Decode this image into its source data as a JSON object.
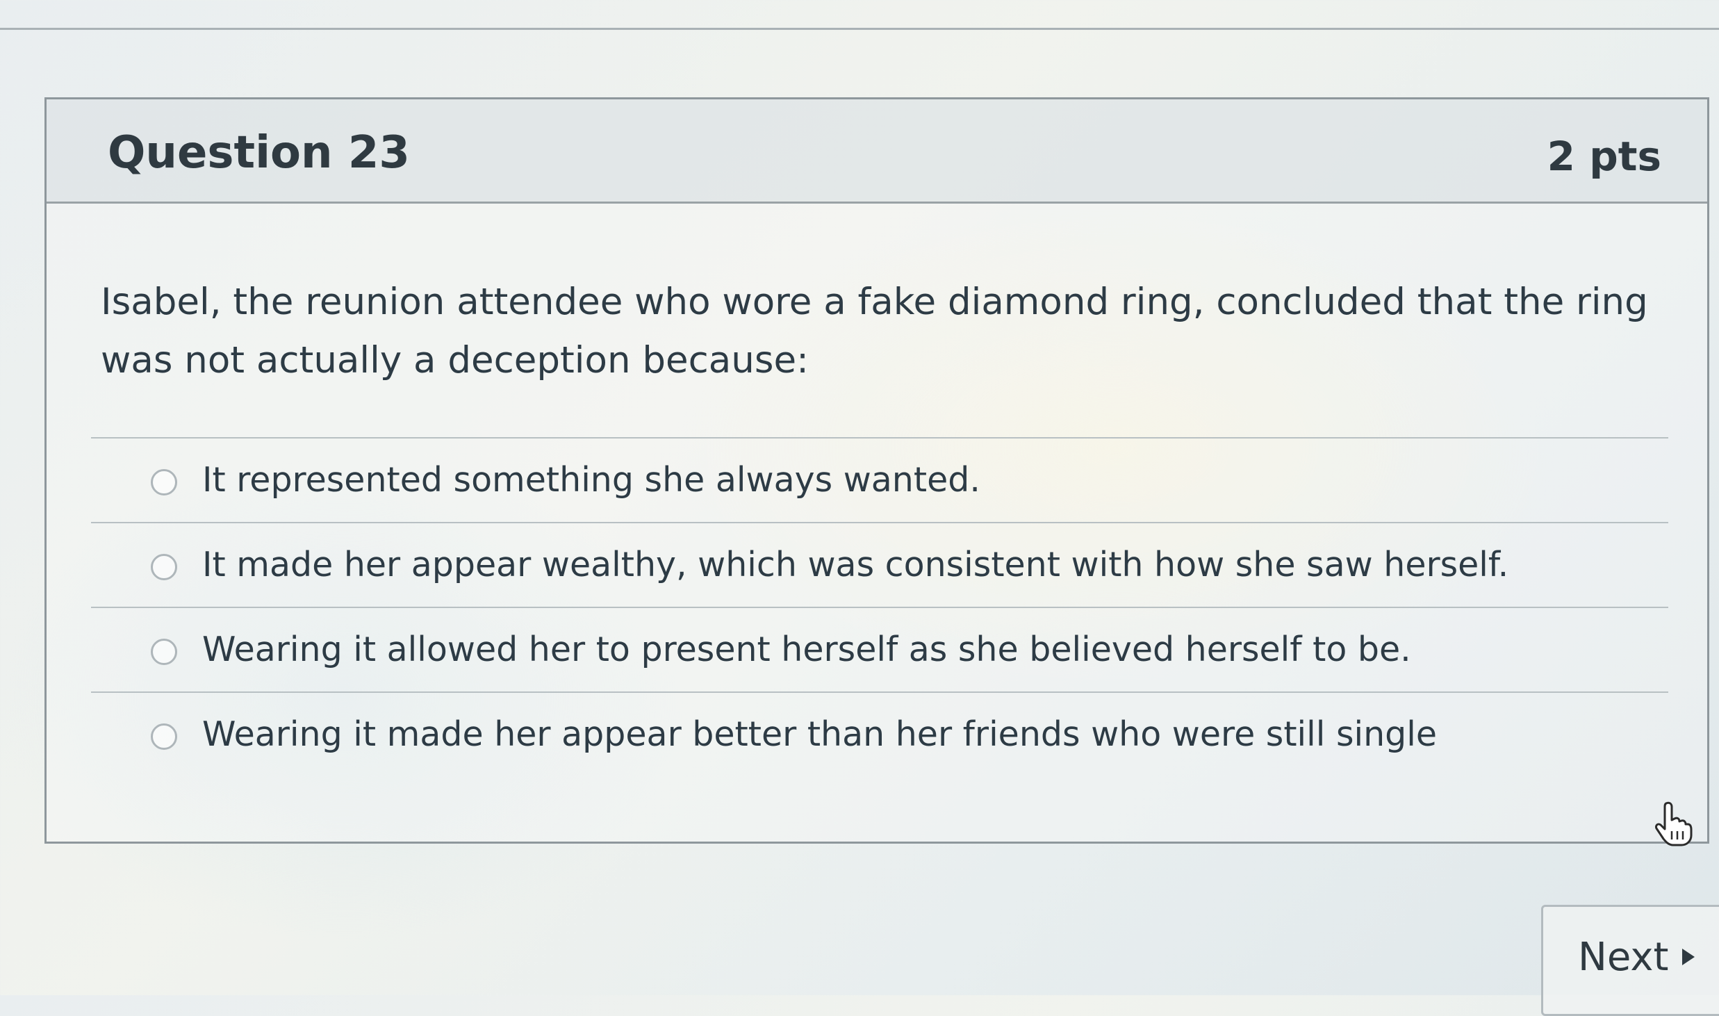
{
  "question": {
    "title": "Question 23",
    "points": "2 pts",
    "text": "Isabel, the reunion attendee who wore a fake diamond ring, concluded that the ring was not actually a deception because:",
    "answers": [
      {
        "label": "It represented something she always wanted."
      },
      {
        "label": "It made her appear wealthy, which was consistent with how she saw herself."
      },
      {
        "label": "Wearing it allowed her to present herself as she believed herself to be."
      },
      {
        "label": "Wearing it made her appear better than her friends who were still single"
      }
    ]
  },
  "navigation": {
    "next_label": "Next",
    "next_icon": "play-arrow-icon"
  },
  "icons": {
    "cursor": "hand-pointer-icon"
  }
}
